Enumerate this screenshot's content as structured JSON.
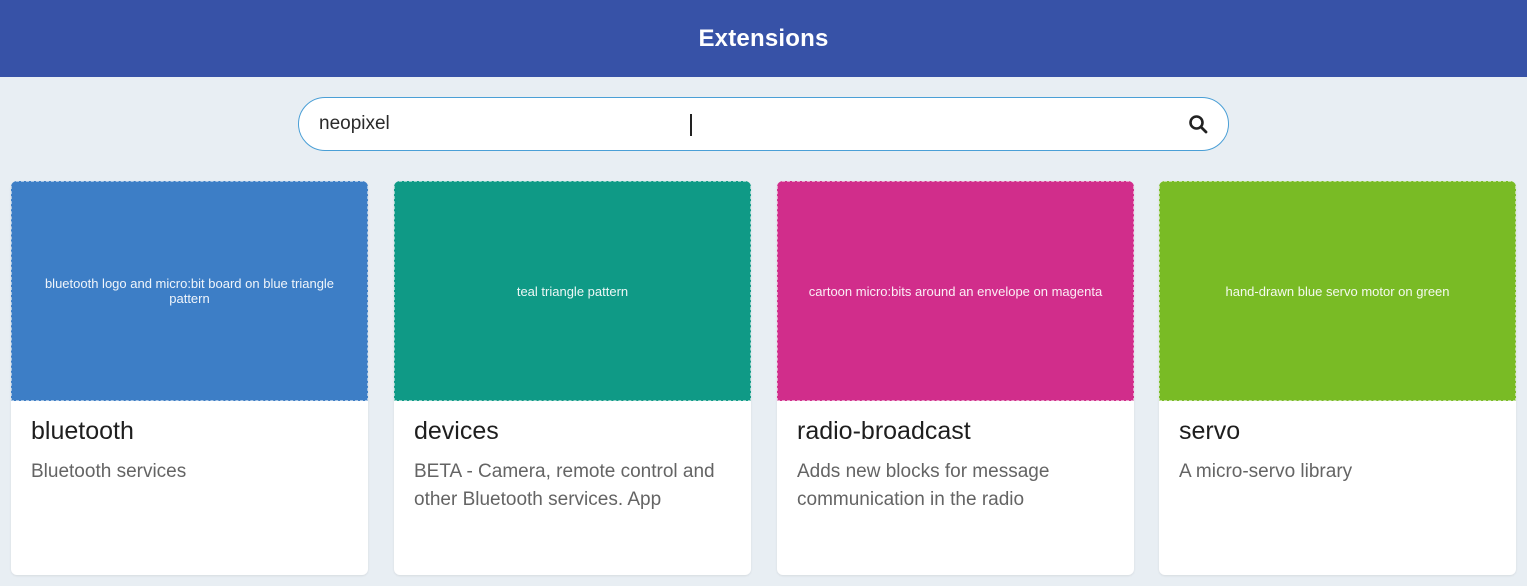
{
  "header": {
    "title": "Extensions"
  },
  "search": {
    "value": "neopixel",
    "icon": "search-icon"
  },
  "cards": [
    {
      "title": "bluetooth",
      "description": "Bluetooth services",
      "image_label": "bluetooth logo and micro:bit board on blue triangle pattern",
      "color": "#3d7ec6"
    },
    {
      "title": "devices",
      "description": "BETA - Camera, remote control and other Bluetooth services. App",
      "image_label": "teal triangle pattern",
      "color": "#0f9a86"
    },
    {
      "title": "radio-broadcast",
      "description": "Adds new blocks for message communication in the radio",
      "image_label": "cartoon micro:bits around an envelope on magenta",
      "color": "#d12d8b"
    },
    {
      "title": "servo",
      "description": "A micro-servo library",
      "image_label": "hand-drawn blue servo motor on green",
      "color": "#79bb25"
    }
  ]
}
